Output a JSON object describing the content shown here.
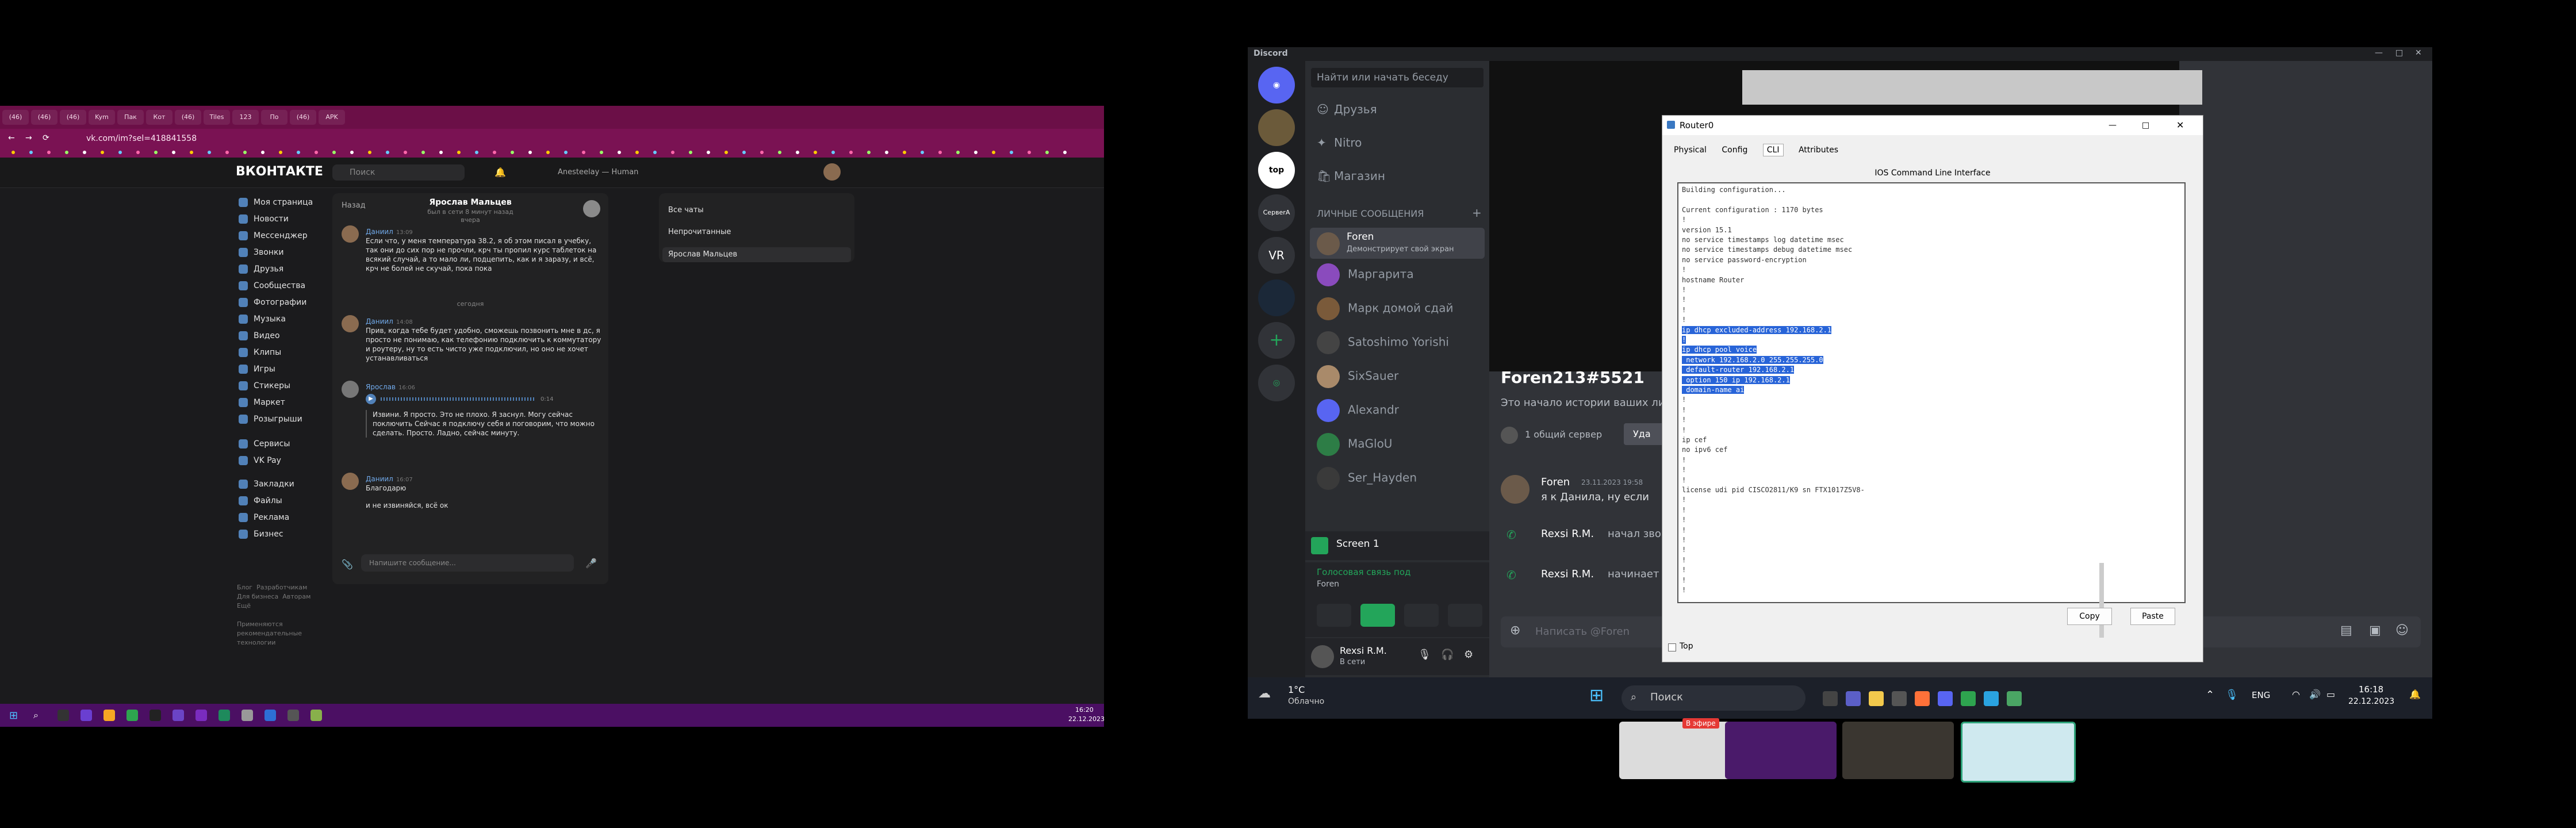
{
  "browser": {
    "url": "vk.com/im?sel=418841558",
    "tabs": [
      "(46)",
      "(46)",
      "(46)",
      "Kym",
      "Пак",
      "Кот",
      "(46)",
      "Tiles",
      "123",
      "По",
      "(46)",
      "APK"
    ]
  },
  "vk": {
    "logo": "ВКОНТАКТЕ",
    "search_placeholder": "Поиск",
    "music_now": "Anesteelay — Human",
    "sidebar": [
      "Моя страница",
      "Новости",
      "Мессенджер",
      "Звонки",
      "Друзья",
      "Сообщества",
      "Фотографии",
      "Музыка",
      "Видео",
      "Клипы",
      "Игры",
      "Стикеры",
      "Маркет",
      "Розыгрыши",
      "Сервисы",
      "VK Pay",
      "Закладки",
      "Файлы",
      "Реклама",
      "Бизнес"
    ],
    "footer": [
      "Блог",
      "Разработчикам",
      "Для бизнеса",
      "Авторам",
      "Ещё"
    ],
    "footer_note": "Применяются рекомендательные технологии",
    "chat": {
      "back": "Назад",
      "contact": "Ярослав Мальцев",
      "status": "был в сети 8 минут назад",
      "yesterday": "вчера",
      "today": "сегодня",
      "messages": [
        {
          "name": "Даниил",
          "time": "13:09",
          "text": "Если что, у меня температура 38.2, я об этом писал в учебку, так они до сих пор не прочли, крч ты пропил курс таблеток на всякий случай, а то мало ли, подцепить, как и я заразу, и всё, крч не болей не скучай, пока пока"
        },
        {
          "name": "Даниил",
          "time": "14:08",
          "text": "Прив, когда тебе будет удобно, сможешь позвонить мне в дс, я просто не понимаю, как телефонию подключить к коммутатору и роутеру, ну то есть чисто уже подключил, но оно не хочет устанавливаться"
        },
        {
          "name": "Ярослав",
          "time": "16:06",
          "voice_duration": "0:14",
          "text": "Извини. Я просто. Это не плохо. Я заснул. Могу сейчас поключить Сейчас я подключу себя и поговорим, что можно сделать. Просто. Ладно, сейчас минуту."
        },
        {
          "name": "Даниил",
          "time": "16:07",
          "text": "Благодарю"
        },
        {
          "name": "Даниил",
          "time": "",
          "text": "и не извиняйся, всё ок"
        }
      ],
      "input_placeholder": "Напишите сообщение..."
    },
    "chatlist": [
      "Все чаты",
      "Непрочитанные",
      "Ярослав Мальцев"
    ]
  },
  "taskbar_left": {
    "time": "16:20",
    "date": "22.12.2023"
  },
  "discord": {
    "app_title": "Discord",
    "search_placeholder": "Найти или начать беседу",
    "nav": [
      "Друзья",
      "Nitro",
      "Магазин"
    ],
    "dm_header": "ЛИЧНЫЕ СООБЩЕНИЯ",
    "dms": [
      {
        "name": "Foren",
        "sub": "Демонстрирует свой экран"
      },
      {
        "name": "Маргарита",
        "sub": ""
      },
      {
        "name": "Марк домой сдай",
        "sub": ""
      },
      {
        "name": "Satoshimo Yorishi",
        "sub": ""
      },
      {
        "name": "SixSauer",
        "sub": ""
      },
      {
        "name": "Alexandr",
        "sub": ""
      },
      {
        "name": "MaGloU",
        "sub": ""
      },
      {
        "name": "Ser_Hayden",
        "sub": ""
      }
    ],
    "guilds": [
      "top",
      "СервerA",
      "VR"
    ],
    "screen_share": "Screen 1",
    "voice_status": "Голосовая связь под",
    "voice_user": "Foren",
    "user": {
      "name": "Rexsi R.M.",
      "status": "В сети"
    },
    "main": {
      "channel_title": "Foren213#5521",
      "intro": "Это начало истории ваших ли",
      "mutual": "1 общий сервер",
      "remove_btn": "Уда",
      "messages": [
        {
          "name": "Foren",
          "time": "23.11.2023 19:58",
          "text": "я к Данила, ну если"
        },
        {
          "name": "Rexsi R.M.",
          "time": "",
          "text": "начал звон"
        },
        {
          "name": "Rexsi R.M.",
          "time": "",
          "text": "начинает з"
        }
      ],
      "input_placeholder": "Написать @Foren"
    }
  },
  "router": {
    "title": "Router0",
    "tabs": [
      "Physical",
      "Config",
      "CLI",
      "Attributes"
    ],
    "cli_header": "IOS Command Line Interface",
    "lines": [
      "Building configuration...",
      "",
      "Current configuration : 1170 bytes",
      "!",
      "version 15.1",
      "no service timestamps log datetime msec",
      "no service timestamps debug datetime msec",
      "no service password-encryption",
      "!",
      "hostname Router",
      "!",
      "!",
      "!",
      "!",
      "ip dhcp excluded-address 192.168.2.1",
      "!",
      "ip dhcp pool voice",
      " network 192.168.2.0 255.255.255.0",
      " default-router 192.168.2.1",
      " option 150 ip 192.168.2.1",
      " domain-name ai",
      "!",
      "!",
      "!",
      "!",
      "ip cef",
      "no ipv6 cef",
      "!",
      "!",
      "!",
      "license udi pid CISCO2811/K9 sn FTX1017Z5V8-",
      "!",
      "!",
      "!",
      "!",
      "!",
      "!",
      "!",
      "!",
      "!",
      "!"
    ],
    "selected_from": 14,
    "selected_to": 20,
    "copy_btn": "Copy",
    "paste_btn": "Paste",
    "top_checkbox": "Top"
  },
  "taskbar_right": {
    "weather_temp": "1°C",
    "weather_desc": "Облачно",
    "search": "Поиск",
    "lang": "ENG",
    "time": "16:18",
    "date": "22.12.2023"
  },
  "thumbnail_badge": "В эфире"
}
